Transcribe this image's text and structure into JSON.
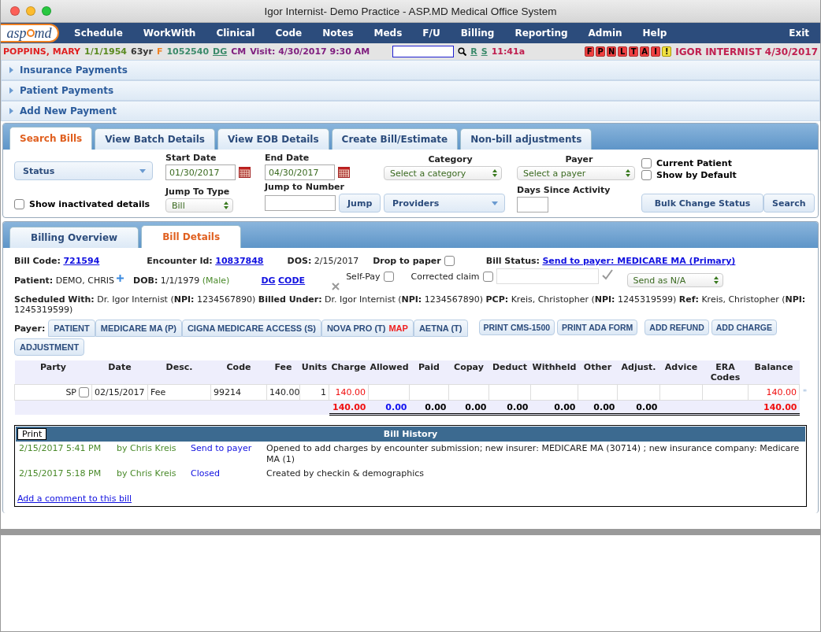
{
  "window": {
    "title": "Igor Internist- Demo Practice - ASP.MD Medical Office System"
  },
  "nav": {
    "logo_left": "asp",
    "logo_right": "md",
    "items": [
      "Schedule",
      "WorkWith",
      "Clinical",
      "Code",
      "Notes",
      "Meds",
      "F/U",
      "Billing",
      "Reporting",
      "Admin",
      "Help"
    ],
    "exit": "Exit"
  },
  "patient_bar": {
    "items": [
      {
        "text": "POPPINS, MARY",
        "kind": "name"
      },
      {
        "text": "1/1/1954",
        "kind": "dob"
      },
      {
        "text": "63yr",
        "kind": "age"
      },
      {
        "text": "F",
        "kind": "sex"
      },
      {
        "text": "1052540",
        "kind": "id"
      },
      {
        "text": "DG",
        "kind": "link"
      },
      {
        "text": "CM",
        "kind": "visit"
      },
      {
        "text": "Visit: 4/30/2017 9:30 AM",
        "kind": "visit"
      }
    ],
    "links": [
      "R",
      "S"
    ],
    "time": "11:41a",
    "flags": [
      {
        "label": "F",
        "kind": "alert"
      },
      {
        "label": "P",
        "kind": "alert"
      },
      {
        "label": "N",
        "kind": "alert"
      },
      {
        "label": "L",
        "kind": "alert"
      },
      {
        "label": "T",
        "kind": "alert"
      },
      {
        "label": "A",
        "kind": "alert"
      },
      {
        "label": "I",
        "kind": "alert"
      },
      {
        "label": "!",
        "kind": "warning"
      }
    ],
    "provider": "IGOR INTERNIST 4/30/2017"
  },
  "accordion": [
    {
      "label": "Insurance Payments",
      "expanded": false
    },
    {
      "label": "Patient Payments",
      "expanded": false
    },
    {
      "label": "Add New Payment",
      "expanded": false
    }
  ],
  "search_panel": {
    "tabs": [
      {
        "label": "Search Bills",
        "selected": true
      },
      {
        "label": "View Batch Details",
        "selected": false
      },
      {
        "label": "View EOB Details",
        "selected": false
      },
      {
        "label": "Create Bill/Estimate",
        "selected": false
      },
      {
        "label": "Non-bill adjustments",
        "selected": false
      }
    ],
    "status": "Status",
    "start_date": {
      "label": "Start Date",
      "value": "01/30/2017"
    },
    "end_date": {
      "label": "End Date",
      "value": "04/30/2017"
    },
    "category": {
      "label": "Category",
      "placeholder": "Select a category"
    },
    "payer": {
      "label": "Payer",
      "placeholder": "Select a payer"
    },
    "current_patient": {
      "label": "Current Patient",
      "checked": false
    },
    "show_by_default": {
      "label": "Show by Default",
      "checked": false
    },
    "show_inactivated": {
      "label": "Show inactivated details",
      "checked": false
    },
    "jump_to_type": {
      "label": "Jump To Type",
      "value": "Bill"
    },
    "jump_to_number": {
      "label": "Jump to Number"
    },
    "jump_button": "Jump",
    "providers": "Providers",
    "days_since_activity": {
      "label": "Days Since Activity"
    },
    "bulk_button": "Bulk Change Status",
    "search_button": "Search"
  },
  "bill_panel": {
    "tabs": [
      {
        "label": "Billing Overview",
        "selected": false
      },
      {
        "label": "Bill Details",
        "selected": true
      }
    ],
    "bill_code": {
      "label": "Bill Code:",
      "value": "721594"
    },
    "encounter": {
      "label": "Encounter Id:",
      "value": "10837848"
    },
    "dos": {
      "label": "DOS:",
      "value": "2/15/2017"
    },
    "drop_to_paper": {
      "label": "Drop to paper",
      "checked": false
    },
    "bill_status": {
      "label": "Bill Status:",
      "value": "Send to payer: MEDICARE MA (Primary)"
    },
    "patient": {
      "label": "Patient:",
      "value": "DEMO, CHRIS"
    },
    "dob": {
      "label": "DOB:",
      "value": "1/1/1979",
      "sex": "(Male)"
    },
    "links": [
      "DG",
      "CODE"
    ],
    "self_pay": {
      "label": "Self-Pay",
      "checked": false
    },
    "corrected_claim": {
      "label": "Corrected claim",
      "checked": false
    },
    "send_as": "Send as N/A",
    "providers": "**Scheduled With:** Dr. Igor Internist (**NPI:** 1234567890)   **Billed Under:** Dr. Igor Internist (**NPI:** 1234567890)   **PCP:** Kreis, Christopher (**NPI:** 1245319599)   **Ref:** Kreis, Christopher (**NPI:** 1245319599)",
    "payer_label": "Payer:",
    "payers": [
      {
        "label": "PATIENT"
      },
      {
        "label": "MEDICARE MA (P)"
      },
      {
        "label": "CIGNA MEDICARE ACCESS (S)"
      },
      {
        "label": "NOVA PRO (T)",
        "tag": "MAP"
      },
      {
        "label": "AETNA (T)"
      },
      {
        "label": "ADJUSTMENT"
      }
    ],
    "actions": [
      "PRINT CMS-1500",
      "PRINT ADA FORM",
      "ADD REFUND",
      "ADD CHARGE"
    ],
    "table": {
      "columns": [
        {
          "label": "Party"
        },
        {
          "label": "Date"
        },
        {
          "label": "Desc."
        },
        {
          "label": "Code"
        },
        {
          "label": "Fee"
        },
        {
          "label": "Units"
        },
        {
          "label": "Charge",
          "total": "140.00",
          "color": "#f01010"
        },
        {
          "label": "Allowed",
          "total": "0.00",
          "color": "#1010f0"
        },
        {
          "label": "Paid",
          "total": "0.00"
        },
        {
          "label": "Copay",
          "total": "0.00"
        },
        {
          "label": "Deduct",
          "total": "0.00"
        },
        {
          "label": "Withheld",
          "total": "0.00"
        },
        {
          "label": "Other",
          "total": "0.00"
        },
        {
          "label": "Adjust.",
          "total": "0.00"
        },
        {
          "label": "Advice"
        },
        {
          "label": "ERA Codes"
        },
        {
          "label": "Balance",
          "total": "140.00",
          "color": "#f01010"
        }
      ],
      "rows": [
        {
          "checked": false,
          "cells": [
            "SP",
            "02/15/2017",
            "Fee",
            "99214",
            "140.00",
            "1",
            "140.00",
            null,
            null,
            null,
            null,
            null,
            null,
            null,
            null,
            null,
            "140.00"
          ]
        }
      ]
    },
    "history": {
      "print": "Print",
      "title": "Bill History",
      "entries": [
        {
          "time": "2/15/2017 5:41 PM",
          "by": "by Chris Kreis",
          "status": "Send to payer",
          "note": "Opened to add charges by encounter submission; new insurer: MEDICARE MA (30714) ; new insurance company: Medicare MA (1)"
        },
        {
          "time": "2/15/2017 5:18 PM",
          "by": "by Chris Kreis",
          "status": "Closed",
          "note": "Created by checkin & demographics"
        }
      ],
      "add_comment": "Add a comment to this bill"
    }
  }
}
